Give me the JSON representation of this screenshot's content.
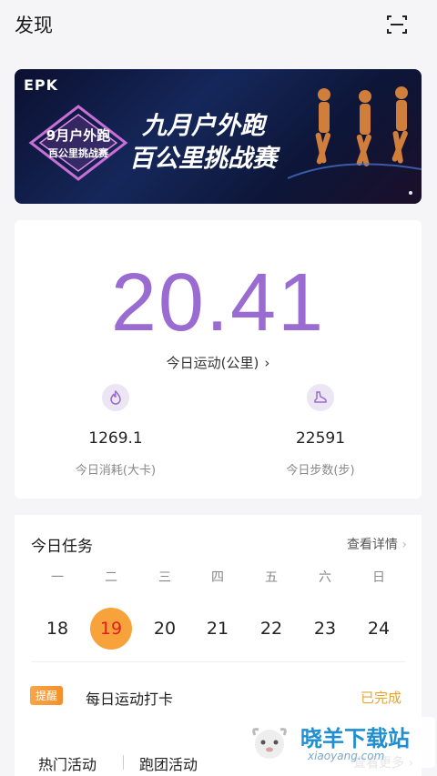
{
  "header": {
    "title": "发现",
    "scan_icon": "scan-icon"
  },
  "banner": {
    "brand": "EPK",
    "line1": "九月户外跑",
    "line2": "百公里挑战赛",
    "emblem_line1": "9月户外跑",
    "emblem_line2": "百公里挑战赛"
  },
  "today": {
    "distance": "20.41",
    "distance_label": "今日运动(公里)",
    "calories_value": "1269.1",
    "calories_label": "今日消耗(大卡)",
    "calories_icon": "flame-icon",
    "steps_value": "22591",
    "steps_label": "今日步数(步)",
    "steps_icon": "shoe-icon"
  },
  "tasks": {
    "title": "今日任务",
    "more": "查看详情",
    "weekdays": [
      "一",
      "二",
      "三",
      "四",
      "五",
      "六",
      "日"
    ],
    "dates": [
      "18",
      "19",
      "20",
      "21",
      "22",
      "23",
      "24"
    ],
    "active_date": "19",
    "badge": "提醒",
    "checkin_label": "每日运动打卡",
    "checkin_status": "已完成"
  },
  "bottom": {
    "tab1": "热门活动",
    "tab2": "跑团活动",
    "more": "查看更多"
  },
  "watermark": {
    "title": "晓羊下载站",
    "url": "xiaoyang.com"
  },
  "colors": {
    "accent": "#9a6bd0",
    "orange": "#f7a23b",
    "done": "#e5a436"
  }
}
